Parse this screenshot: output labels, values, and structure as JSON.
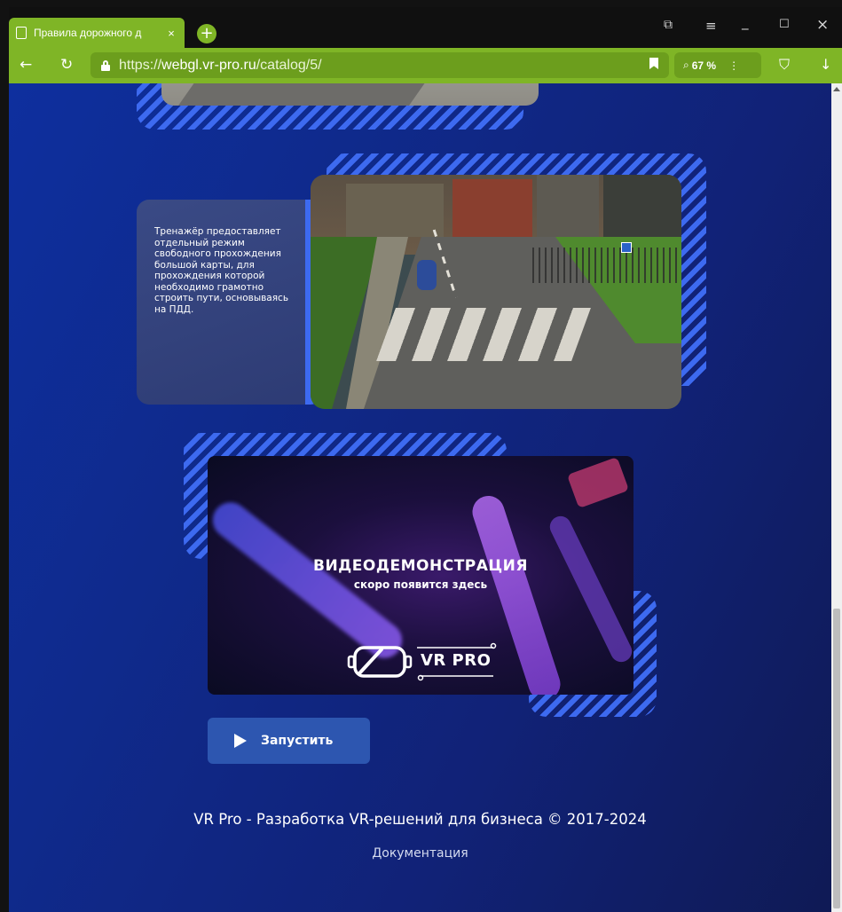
{
  "browser": {
    "tab_title": "Правила дорожного д",
    "tab_close": "×",
    "new_tab": "+",
    "url_scheme": "https://",
    "url_host": "webgl.vr-pro.ru",
    "url_path": "/catalog/5/",
    "zoom_label": "67 %",
    "accent_color": "#7fb526"
  },
  "window_controls": {
    "minimize": "_",
    "maximize": "☐",
    "close": "×",
    "menu": "≡"
  },
  "content": {
    "description": "Тренажёр предоставляет отдельный режим свободного прохождения большой карты, для прохождения которой необходимо грамотно строить пути, основываясь на ПДД.",
    "video": {
      "title": "ВИДЕОДЕМОНСТРАЦИЯ",
      "subtitle": "скоро появится здесь",
      "logo_text": "VR PRO"
    },
    "launch_label": "Запустить"
  },
  "footer": {
    "copyright": "VR Pro - Разработка VR-решений для бизнеса © 2017-2024",
    "docs_link": "Документация"
  }
}
